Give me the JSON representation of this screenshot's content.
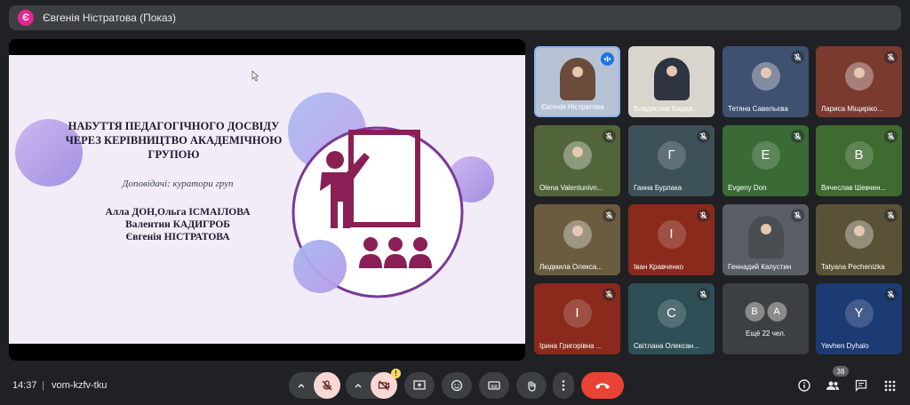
{
  "meeting": {
    "presenter_initial": "Є",
    "presenting_title": "Євгенія Ністратова (Показ)",
    "time": "14:37",
    "separator": "|",
    "code": "vom-kzfv-tku",
    "people_count": "38"
  },
  "slide": {
    "title": "НАБУТТЯ ПЕДАГОГІЧНОГО ДОСВІДУ ЧЕРЕЗ КЕРІВНИЦТВО АКАДЕМІЧНОЮ ГРУПОЮ",
    "speakers_label": "Доповідачі: куратори груп",
    "names": [
      "Алла ДОН,Ольга ІСМАІЛОВА",
      "Валентин КАДИГРОБ",
      "Євгенія НІСТРАТОВА"
    ]
  },
  "participants": [
    {
      "name": "Євгенія Ністратова",
      "initial": "",
      "color": "#b7c3d4",
      "mic": "active"
    },
    {
      "name": "Владислав Барда...",
      "initial": "",
      "color": "#d9d4cc",
      "mic": "none"
    },
    {
      "name": "Тетяна Савельєва",
      "initial": "",
      "color": "#3f5170",
      "mic": "muted"
    },
    {
      "name": "Лариса Міщиріко...",
      "initial": "",
      "color": "#7a3a30",
      "mic": "muted"
    },
    {
      "name": "Olena Valentunivn...",
      "initial": "",
      "color": "#52653a",
      "mic": "muted"
    },
    {
      "name": "Ганна Бурлака",
      "initial": "Г",
      "color": "#3d5159",
      "mic": "muted"
    },
    {
      "name": "Evgeny Don",
      "initial": "E",
      "color": "#3a6b36",
      "mic": "muted"
    },
    {
      "name": "Вячеслав Шевчен...",
      "initial": "В",
      "color": "#3f6a30",
      "mic": "muted"
    },
    {
      "name": "Людмила Олекса...",
      "initial": "",
      "color": "#6b5c3f",
      "mic": "muted"
    },
    {
      "name": "Іван Кравченко",
      "initial": "І",
      "color": "#8a2a1d",
      "mic": "muted"
    },
    {
      "name": "Геннадий Капустин",
      "initial": "",
      "color": "#5a5f66",
      "mic": "muted"
    },
    {
      "name": "Tatyana Pechenizka",
      "initial": "",
      "color": "#5a5236",
      "mic": "muted"
    },
    {
      "name": "Ірина Григорівна ...",
      "initial": "І",
      "color": "#8a2a1d",
      "mic": "muted"
    },
    {
      "name": "Світлана Олексан...",
      "initial": "С",
      "color": "#2f4f57",
      "mic": "muted"
    },
    {
      "name": "",
      "initial": "",
      "color": "#3c4043",
      "mic": "none"
    },
    {
      "name": "Yevhen Dyhalo",
      "initial": "Y",
      "color": "#1c3a73",
      "mic": "muted"
    }
  ],
  "more": {
    "avatar_1": "В",
    "avatar_2": "А",
    "label": "Ещё 22 чел."
  },
  "colors": {
    "end_call": "#ea4335",
    "muted_control": "#f9d7d4",
    "control_bg": "#3c4043",
    "accent": "#8ab4f8"
  }
}
